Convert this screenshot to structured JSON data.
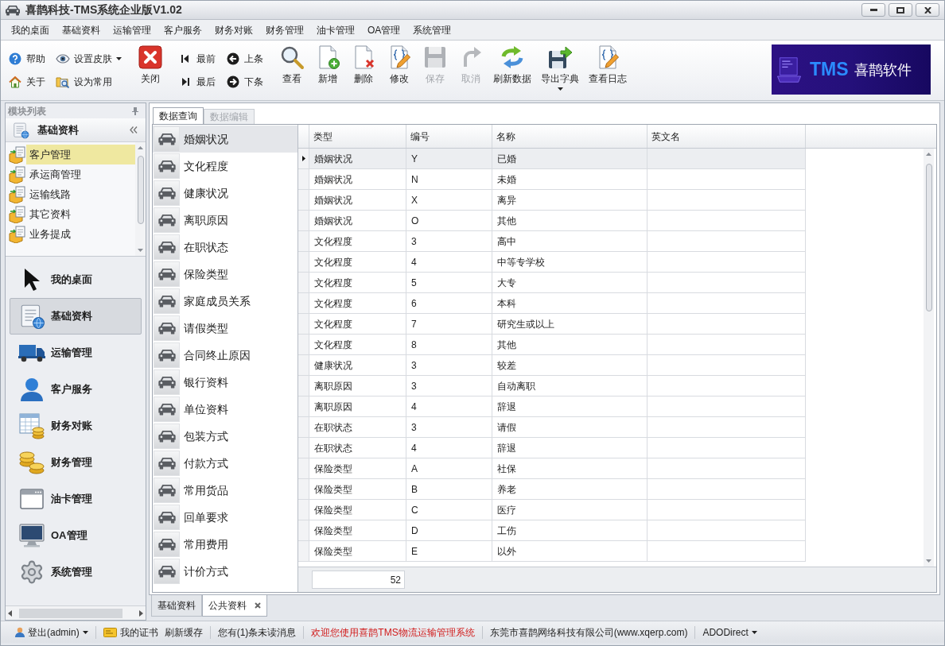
{
  "window": {
    "title": "喜鹊科技-TMS系统企业版V1.02"
  },
  "menu": [
    "我的桌面",
    "基础资料",
    "运输管理",
    "客户服务",
    "财务对账",
    "财务管理",
    "油卡管理",
    "OA管理",
    "系统管理"
  ],
  "toolbar": [
    {
      "kind": "stack",
      "items": [
        {
          "label": "帮助",
          "dropdown": false
        },
        {
          "label": "关于",
          "dropdown": false
        }
      ]
    },
    {
      "kind": "stack",
      "items": [
        {
          "label": "设置皮肤",
          "dropdown": true
        },
        {
          "label": "设为常用",
          "dropdown": false
        }
      ]
    },
    {
      "kind": "large",
      "items": [
        {
          "label": "关闭",
          "disabled": false,
          "dropdown": false
        }
      ]
    },
    {
      "kind": "stack",
      "items": [
        {
          "label": "最前",
          "dropdown": false
        },
        {
          "label": "最后",
          "dropdown": false
        }
      ]
    },
    {
      "kind": "stack",
      "items": [
        {
          "label": "上条",
          "dropdown": false
        },
        {
          "label": "下条",
          "dropdown": false
        }
      ]
    },
    {
      "kind": "large",
      "items": [
        {
          "label": "查看",
          "disabled": false,
          "dropdown": false
        },
        {
          "label": "新增",
          "disabled": false,
          "dropdown": false
        },
        {
          "label": "删除",
          "disabled": false,
          "dropdown": false
        },
        {
          "label": "修改",
          "disabled": false,
          "dropdown": false
        },
        {
          "label": "保存",
          "disabled": true,
          "dropdown": false
        },
        {
          "label": "取消",
          "disabled": true,
          "dropdown": false
        },
        {
          "label": "刷新数据",
          "disabled": false,
          "dropdown": false
        },
        {
          "label": "导出字典",
          "disabled": false,
          "dropdown": true
        },
        {
          "label": "查看日志",
          "disabled": false,
          "dropdown": false
        }
      ]
    }
  ],
  "banner": {
    "brand": "TMS",
    "name": "喜鹊软件"
  },
  "sidebar": {
    "title": "模块列表",
    "group": {
      "title": "基础资料",
      "items": [
        {
          "label": "客户管理",
          "selected": true
        },
        {
          "label": "承运商管理",
          "selected": false
        },
        {
          "label": "运输线路",
          "selected": false
        },
        {
          "label": "其它资料",
          "selected": false
        },
        {
          "label": "业务提成",
          "selected": false
        }
      ]
    },
    "nav": [
      {
        "label": "我的桌面",
        "selected": false
      },
      {
        "label": "基础资料",
        "selected": true
      },
      {
        "label": "运输管理",
        "selected": false
      },
      {
        "label": "客户服务",
        "selected": false
      },
      {
        "label": "财务对账",
        "selected": false
      },
      {
        "label": "财务管理",
        "selected": false
      },
      {
        "label": "油卡管理",
        "selected": false
      },
      {
        "label": "OA管理",
        "selected": false
      },
      {
        "label": "系统管理",
        "selected": false
      }
    ]
  },
  "tabs": [
    {
      "label": "数据查询",
      "selected": true,
      "disabled": false
    },
    {
      "label": "数据编辑",
      "selected": false,
      "disabled": true
    }
  ],
  "categories": [
    {
      "label": "婚姻状况",
      "selected": true
    },
    {
      "label": "文化程度",
      "selected": false
    },
    {
      "label": "健康状况",
      "selected": false
    },
    {
      "label": "离职原因",
      "selected": false
    },
    {
      "label": "在职状态",
      "selected": false
    },
    {
      "label": "保险类型",
      "selected": false
    },
    {
      "label": "家庭成员关系",
      "selected": false
    },
    {
      "label": "请假类型",
      "selected": false
    },
    {
      "label": "合同终止原因",
      "selected": false
    },
    {
      "label": "银行资料",
      "selected": false
    },
    {
      "label": "单位资料",
      "selected": false
    },
    {
      "label": "包装方式",
      "selected": false
    },
    {
      "label": "付款方式",
      "selected": false
    },
    {
      "label": "常用货品",
      "selected": false
    },
    {
      "label": "回单要求",
      "selected": false
    },
    {
      "label": "常用费用",
      "selected": false
    },
    {
      "label": "计价方式",
      "selected": false
    }
  ],
  "table": {
    "columns": [
      "类型",
      "编号",
      "名称",
      "英文名"
    ],
    "rows": [
      {
        "type": "婚姻状况",
        "code": "Y",
        "name": "已婚",
        "selected": true
      },
      {
        "type": "婚姻状况",
        "code": "N",
        "name": "未婚",
        "selected": false
      },
      {
        "type": "婚姻状况",
        "code": "X",
        "name": "离异",
        "selected": false
      },
      {
        "type": "婚姻状况",
        "code": "O",
        "name": "其他",
        "selected": false
      },
      {
        "type": "文化程度",
        "code": "3",
        "name": "高中",
        "selected": false
      },
      {
        "type": "文化程度",
        "code": "4",
        "name": "中等专学校",
        "selected": false
      },
      {
        "type": "文化程度",
        "code": "5",
        "name": "大专",
        "selected": false
      },
      {
        "type": "文化程度",
        "code": "6",
        "name": "本科",
        "selected": false
      },
      {
        "type": "文化程度",
        "code": "7",
        "name": "研究生或以上",
        "selected": false
      },
      {
        "type": "文化程度",
        "code": "8",
        "name": "其他",
        "selected": false
      },
      {
        "type": "健康状况",
        "code": "3",
        "name": "较差",
        "selected": false
      },
      {
        "type": "离职原因",
        "code": "3",
        "name": "自动离职",
        "selected": false
      },
      {
        "type": "离职原因",
        "code": "4",
        "name": "辞退",
        "selected": false
      },
      {
        "type": "在职状态",
        "code": "3",
        "name": "请假",
        "selected": false
      },
      {
        "type": "在职状态",
        "code": "4",
        "name": "辞退",
        "selected": false
      },
      {
        "type": "保险类型",
        "code": "A",
        "name": "社保",
        "selected": false
      },
      {
        "type": "保险类型",
        "code": "B",
        "name": "养老",
        "selected": false
      },
      {
        "type": "保险类型",
        "code": "C",
        "name": "医疗",
        "selected": false
      },
      {
        "type": "保险类型",
        "code": "D",
        "name": "工伤",
        "selected": false
      },
      {
        "type": "保险类型",
        "code": "E",
        "name": "以外",
        "selected": false
      }
    ],
    "footer": "52"
  },
  "doc_tabs": [
    {
      "label": "基础资料",
      "selected": false,
      "closable": false
    },
    {
      "label": "公共资料",
      "selected": true,
      "closable": true
    }
  ],
  "status_bar": [
    {
      "items": [
        {
          "kind": "user",
          "label": "登出(admin)",
          "dropdown": true
        }
      ]
    },
    {
      "items": [
        {
          "kind": "cert",
          "label": "我的证书",
          "dropdown": false
        },
        {
          "kind": "link",
          "label": "刷新缓存",
          "dropdown": false
        }
      ]
    },
    {
      "items": [
        {
          "kind": "link",
          "label": "您有(1)条未读消息",
          "dropdown": false
        }
      ]
    },
    {
      "items": [
        {
          "kind": "notice",
          "label": "欢迎您使用喜鹊TMS物流运输管理系统",
          "dropdown": false
        }
      ]
    },
    {
      "items": [
        {
          "kind": "info",
          "label": "东莞市喜鹊网络科技有限公司(www.xqerp.com)",
          "dropdown": false
        }
      ]
    },
    {
      "items": [
        {
          "kind": "link",
          "label": "ADODirect",
          "dropdown": true
        }
      ]
    }
  ]
}
